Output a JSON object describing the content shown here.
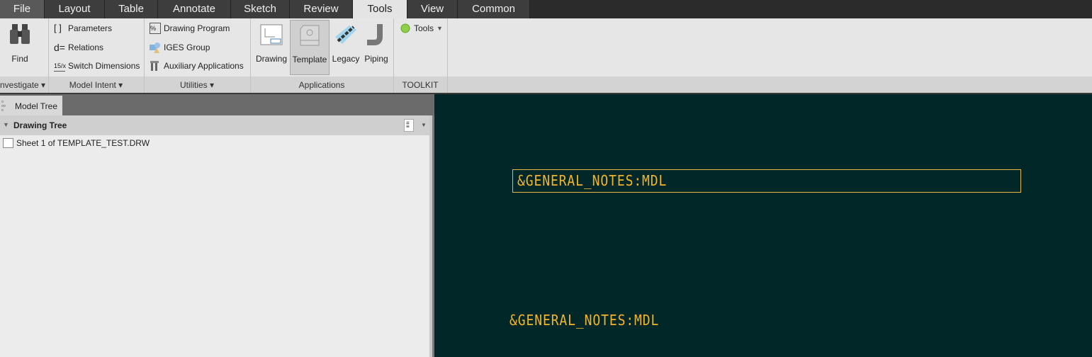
{
  "tabs": [
    "File",
    "Layout",
    "Table",
    "Annotate",
    "Sketch",
    "Review",
    "Tools",
    "View",
    "Common"
  ],
  "active_tab": "Tools",
  "ribbon": {
    "investigate": {
      "find": "Find",
      "label": "nvestigate"
    },
    "model_intent": {
      "items": [
        "Parameters",
        "Relations",
        "Switch Dimensions"
      ],
      "label": "Model Intent"
    },
    "utilities": {
      "items": [
        "Drawing Program",
        "IGES Group",
        "Auxiliary Applications"
      ],
      "label": "Utilities"
    },
    "applications": {
      "items": [
        "Drawing",
        "Template",
        "Legacy",
        "Piping"
      ],
      "label": "Applications"
    },
    "toolkit": {
      "tools": "Tools",
      "label": "TOOLKIT"
    }
  },
  "panel": {
    "tab": "Model Tree",
    "header": "Drawing Tree",
    "items": [
      "Sheet 1 of TEMPLATE_TEST.DRW"
    ]
  },
  "canvas": {
    "notes": [
      "&GENERAL_NOTES:MDL",
      "&GENERAL_NOTES:MDL"
    ],
    "note_color": "#f2b52a",
    "bg": "#012729"
  }
}
